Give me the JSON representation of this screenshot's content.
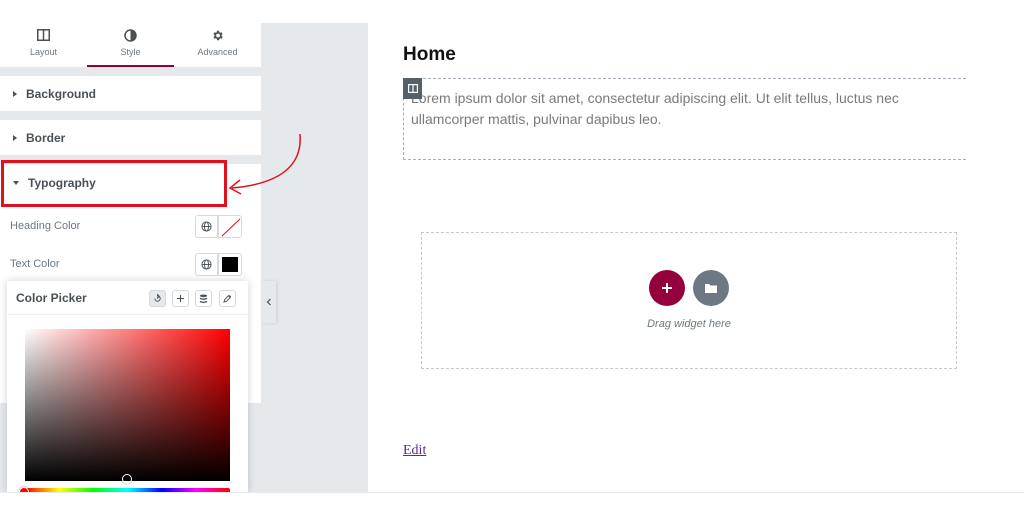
{
  "tabs": [
    {
      "label": "Layout",
      "icon": "columns-icon"
    },
    {
      "label": "Style",
      "icon": "half-circle-icon",
      "active": true
    },
    {
      "label": "Advanced",
      "icon": "gear-icon"
    }
  ],
  "sections": {
    "background": "Background",
    "border": "Border",
    "typography": "Typography"
  },
  "controls": {
    "heading_color": "Heading Color",
    "text_color": "Text Color",
    "text_color_value": "#000000"
  },
  "color_picker": {
    "title": "Color Picker",
    "hue": "#ff0000"
  },
  "canvas": {
    "page_title": "Home",
    "lorem": "Lorem ipsum dolor sit amet, consectetur adipiscing elit. Ut elit tellus, luctus nec ullamcorper mattis, pulvinar dapibus leo.",
    "drag_text": "Drag widget here",
    "edit_link": "Edit"
  },
  "colors": {
    "accent": "#93003c",
    "highlight": "#e0101f",
    "panel_gray": "#e6e9ec"
  }
}
